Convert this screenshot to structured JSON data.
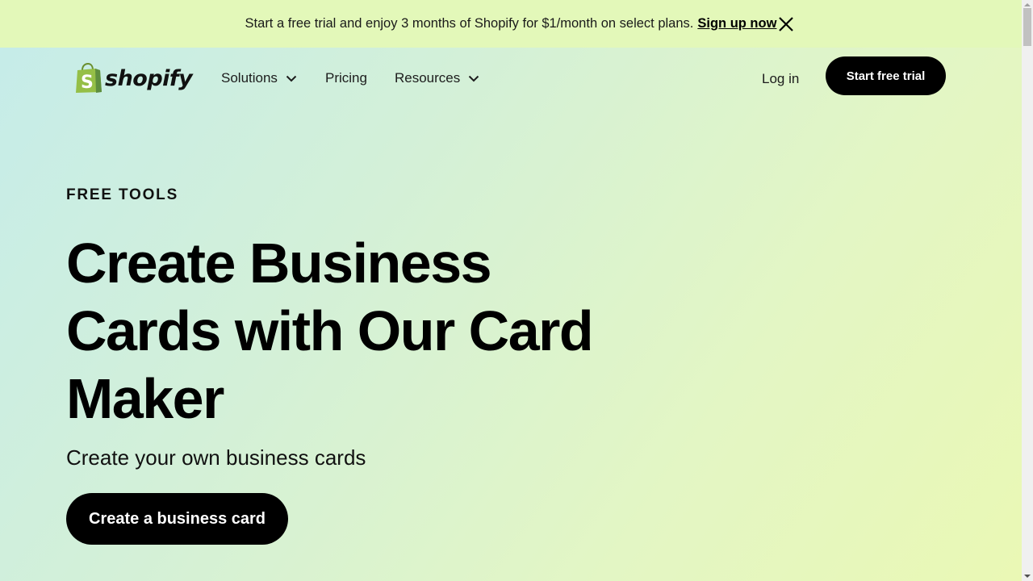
{
  "banner": {
    "message": "Start a free trial and enjoy 3 months of Shopify for $1/month on select plans.",
    "link_label": "Sign up now",
    "close_icon": "close-icon"
  },
  "nav": {
    "logo_text": "shopify",
    "logo_icon": "shopping-bag-icon",
    "items": [
      {
        "label": "Solutions",
        "has_dropdown": true
      },
      {
        "label": "Pricing",
        "has_dropdown": false
      },
      {
        "label": "Resources",
        "has_dropdown": true
      }
    ],
    "login_label": "Log in",
    "trial_label": "Start free trial"
  },
  "hero": {
    "eyebrow": "FREE TOOLS",
    "headline_lines": [
      "Create Business",
      "Cards with Our Card",
      "Maker"
    ],
    "subheading": "Create your own business cards",
    "cta_label": "Create a business card"
  },
  "colors": {
    "brand_green": "#95bf47",
    "button_bg": "#000000",
    "banner_bg": "#e3f8b9"
  }
}
